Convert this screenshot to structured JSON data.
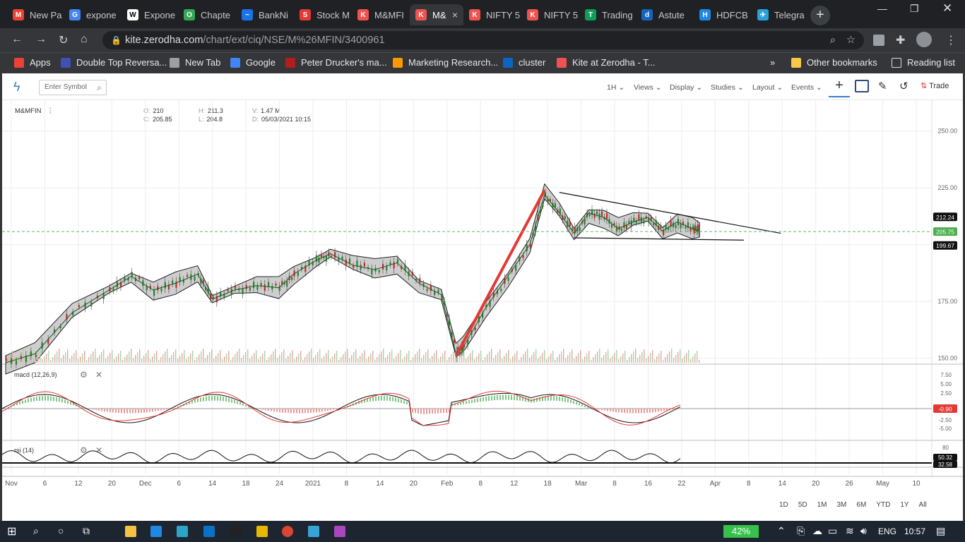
{
  "browser": {
    "tabs": [
      {
        "label": "New Pa",
        "color": "#ea4335",
        "glyph": "M"
      },
      {
        "label": "expone",
        "color": "#4285f4",
        "glyph": "G"
      },
      {
        "label": "Expone",
        "color": "#ffffff",
        "glyph": "W"
      },
      {
        "label": "Chapte",
        "color": "#34a853",
        "glyph": "O"
      },
      {
        "label": "BankNi",
        "color": "#1a73e8",
        "glyph": "~"
      },
      {
        "label": "Stock M",
        "color": "#e53935",
        "glyph": "S"
      },
      {
        "label": "M&MFI",
        "color": "#ef5350",
        "glyph": "K"
      },
      {
        "label": "M&",
        "color": "#ef5350",
        "glyph": "K",
        "active": true
      },
      {
        "label": "NIFTY 5",
        "color": "#ef5350",
        "glyph": "K"
      },
      {
        "label": "NIFTY 5",
        "color": "#ef5350",
        "glyph": "K"
      },
      {
        "label": "Trading",
        "color": "#0f9d58",
        "glyph": "T"
      },
      {
        "label": "Astute",
        "color": "#1565c0",
        "glyph": "d"
      },
      {
        "label": "HDFCB",
        "color": "#1e88e5",
        "glyph": "H"
      },
      {
        "label": "Telegra",
        "color": "#2aa1da",
        "glyph": "✈"
      }
    ],
    "url_host": "kite.zerodha.com",
    "url_path": "/chart/ext/ciq/NSE/M%26MFIN/3400961",
    "bookmarks": [
      {
        "label": "Apps",
        "color": "#ea4335"
      },
      {
        "label": "Double Top Reversa...",
        "color": "#3f51b5"
      },
      {
        "label": "New Tab",
        "color": "#9e9e9e"
      },
      {
        "label": "Google",
        "color": "#4285f4"
      },
      {
        "label": "Peter Drucker's ma...",
        "color": "#b71c1c"
      },
      {
        "label": "Marketing Research...",
        "color": "#ff9800"
      },
      {
        "label": "cluster",
        "color": "#0a66c2"
      },
      {
        "label": "Kite at Zerodha - T...",
        "color": "#ef5350"
      }
    ],
    "other_bookmarks": "Other bookmarks",
    "reading_list": "Reading list",
    "more": "»"
  },
  "kite": {
    "search_placeholder": "Enter Symbol",
    "menus": [
      "1H",
      "Views",
      "Display",
      "Studies",
      "Layout",
      "Events"
    ],
    "trade": "Trade",
    "symbol": "M&MFIN",
    "ohlc": {
      "o_label": "O:",
      "o": "210",
      "c_label": "C:",
      "c": "205.85",
      "h_label": "H:",
      "h": "211.3",
      "l_label": "L:",
      "l": "204.8",
      "v_label": "V:",
      "v": "1.47 M",
      "d_label": "D:",
      "d": "05/03/2021 10:15"
    },
    "ranges": [
      "1D",
      "5D",
      "1M",
      "3M",
      "6M",
      "YTD",
      "1Y",
      "All"
    ],
    "indicators": {
      "macd": "macd (12,26,9)",
      "rsi": "rsi (14)"
    }
  },
  "chart_data": {
    "type": "candlestick",
    "symbol": "M&MFIN",
    "interval": "1H",
    "y_ticks": [
      150,
      175,
      200,
      225,
      250
    ],
    "y_tick_labels": [
      "150.00",
      "175.00",
      "200.00",
      "225.00",
      "250.00"
    ],
    "ylim": [
      148,
      258
    ],
    "price_tags": [
      {
        "value": 212.24,
        "label": "212.24",
        "color": "#111111"
      },
      {
        "value": 205.75,
        "label": "205.75",
        "color": "#4caf50"
      },
      {
        "value": 199.67,
        "label": "199.67",
        "color": "#111111"
      }
    ],
    "x_tick_labels": [
      "Nov",
      "6",
      "12",
      "20",
      "Dec",
      "6",
      "14",
      "18",
      "24",
      "2021",
      "8",
      "14",
      "20",
      "Feb",
      "8",
      "12",
      "18",
      "Mar",
      "8",
      "16",
      "22",
      "Apr",
      "8",
      "14",
      "20",
      "26",
      "May",
      "10"
    ],
    "close_path": [
      [
        0,
        148
      ],
      [
        0.04,
        152
      ],
      [
        0.09,
        170
      ],
      [
        0.14,
        180
      ],
      [
        0.17,
        186
      ],
      [
        0.2,
        180
      ],
      [
        0.23,
        183
      ],
      [
        0.26,
        187
      ],
      [
        0.28,
        176
      ],
      [
        0.31,
        180
      ],
      [
        0.34,
        182
      ],
      [
        0.37,
        181
      ],
      [
        0.39,
        187
      ],
      [
        0.42,
        193
      ],
      [
        0.44,
        196
      ],
      [
        0.47,
        191
      ],
      [
        0.5,
        189
      ],
      [
        0.53,
        192
      ],
      [
        0.56,
        183
      ],
      [
        0.59,
        178
      ],
      [
        0.61,
        152
      ],
      [
        0.62,
        155
      ],
      [
        0.65,
        172
      ],
      [
        0.68,
        186
      ],
      [
        0.71,
        200
      ],
      [
        0.73,
        222
      ],
      [
        0.75,
        214
      ],
      [
        0.77,
        205
      ],
      [
        0.79,
        214
      ],
      [
        0.81,
        212
      ],
      [
        0.83,
        207
      ],
      [
        0.85,
        210
      ],
      [
        0.87,
        212
      ],
      [
        0.89,
        206
      ],
      [
        0.91,
        210
      ],
      [
        0.93,
        207
      ],
      [
        0.94,
        205.85
      ]
    ],
    "annotations": [
      {
        "type": "trendline",
        "color": "#e53935",
        "from": [
          0.61,
          151
        ],
        "to": [
          0.73,
          224
        ]
      },
      {
        "type": "trendline",
        "color": "#111111",
        "from": [
          0.75,
          223
        ],
        "to": [
          1.05,
          205
        ]
      },
      {
        "type": "trendline",
        "color": "#111111",
        "from": [
          0.77,
          203
        ],
        "to": [
          1.0,
          202
        ]
      }
    ],
    "macd_ticks": [
      "7.50",
      "5.00",
      "2.50",
      "-0.90",
      "-2.50",
      "-5.00"
    ],
    "macd_tag": "-0.90",
    "rsi_ticks": [
      "80"
    ],
    "rsi_tags": [
      "50.32",
      "32.58"
    ]
  },
  "taskbar": {
    "battery": "42%",
    "lang": "ENG",
    "time": "10:57"
  }
}
